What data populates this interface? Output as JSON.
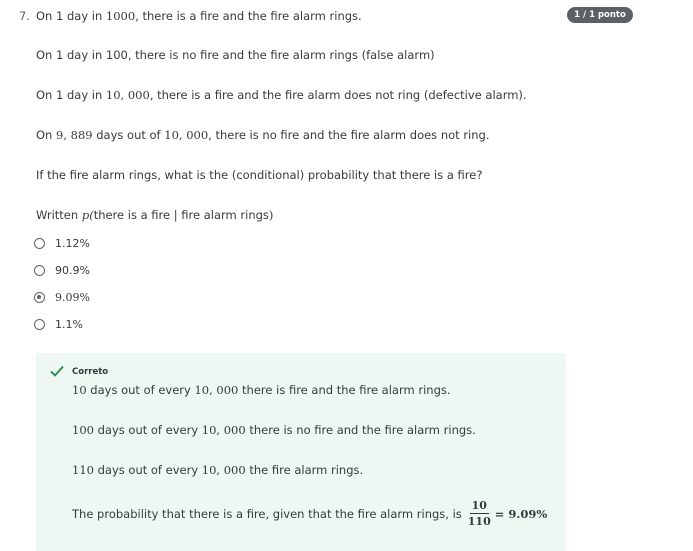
{
  "question": {
    "number": "7.",
    "badge": "1 / 1 ponto",
    "line1": {
      "a": "On 1 day in ",
      "m1": "1000",
      "b": ", there is a fire and the fire alarm rings."
    },
    "line2": {
      "a": "On 1 day in 100, there is no fire and the fire alarm rings (false alarm)"
    },
    "line3": {
      "a": "On 1 day in ",
      "m1": "10, 000",
      "b": ", there is a fire and the fire alarm does not ring (defective alarm)."
    },
    "line4": {
      "a": "On ",
      "m1": "9, 889",
      "b": " days out of ",
      "m2": "10, 000",
      "c": ", there is no fire and the fire alarm does not ring."
    },
    "line5": "If the fire alarm rings, what is the (conditional) probability that there is a fire?",
    "line6": {
      "a": "Written ",
      "m1": "p(",
      "b": "there is a fire | fire alarm rings",
      "m2": ")"
    }
  },
  "options": [
    {
      "label": "1.12%",
      "selected": false
    },
    {
      "label": "90.9%",
      "selected": false
    },
    {
      "label": "9.09%",
      "selected": true
    },
    {
      "label": "1.1%",
      "selected": false
    }
  ],
  "feedback": {
    "status": "Correto",
    "accent": "#1e8c45",
    "background": "#eef7f2",
    "l1": {
      "m1": "10",
      "a": " days out of every ",
      "m2": "10, 000",
      "b": " there is fire and the fire alarm rings."
    },
    "l2": {
      "m1": "100",
      "a": " days out of every ",
      "m2": "10, 000",
      "b": " there is no fire and the fire alarm rings."
    },
    "l3": {
      "m1": "110",
      "a": " days out of every ",
      "m2": "10, 000",
      "b": " the fire alarm rings."
    },
    "l4": {
      "a": "The probability that there is a fire, given that the fire alarm rings, is",
      "num": "10",
      "den": "110",
      "result": "= 9.09%"
    }
  }
}
